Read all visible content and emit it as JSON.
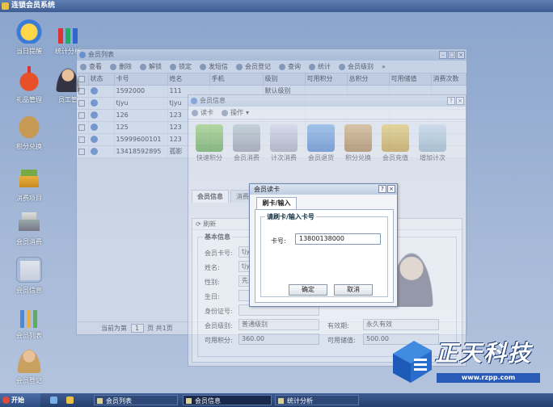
{
  "app": {
    "title": "连锁会员系统"
  },
  "desktop_icons": [
    {
      "label": "当日提醒",
      "icon": "smiley-clock-icon"
    },
    {
      "label": "统计分析",
      "icon": "bar-chart-icon"
    },
    {
      "label": "礼品管理",
      "icon": "gift-icon"
    },
    {
      "label": "员工管",
      "icon": "staff-icon"
    },
    {
      "label": "积分兑换",
      "icon": "money-bag-icon"
    },
    {
      "label": "消费项目",
      "icon": "basket-icon"
    },
    {
      "label": "会员消费",
      "icon": "cash-register-icon"
    },
    {
      "label": "会员信息",
      "icon": "member-card-icon"
    },
    {
      "label": "会员列表",
      "icon": "list-chart-icon"
    },
    {
      "label": "会员登记",
      "icon": "register-person-icon"
    }
  ],
  "member_list_window": {
    "title": "会员列表",
    "toolbar": [
      "查看",
      "删除",
      "解锁",
      "锁定",
      "发短信",
      "会员登记",
      "查询",
      "统计",
      "会员级别"
    ],
    "overflow": "»",
    "columns": [
      "状态",
      "卡号",
      "姓名",
      "手机",
      "级别",
      "可用积分",
      "总积分",
      "可用储值",
      "消费次数"
    ],
    "rows": [
      {
        "card": "1592000",
        "name": "111",
        "level": "默认级别"
      },
      {
        "card": "tjyu",
        "name": "tjyu"
      },
      {
        "card": "126",
        "name": "123"
      },
      {
        "card": "125",
        "name": "123"
      },
      {
        "card": "15999600101",
        "name": "123"
      },
      {
        "card": "13418592895",
        "name": "孤影"
      }
    ],
    "pager": {
      "prefix": "当前为第",
      "page": "1",
      "suffix": "页 共1页"
    }
  },
  "member_info_window": {
    "title": "会员信息",
    "toolbar": [
      "读卡",
      "操作"
    ],
    "actions": [
      "快速积分",
      "会员消费",
      "计次消费",
      "会员退货",
      "积分兑换",
      "会员充值",
      "增加计次"
    ],
    "tabs": [
      "会员信息",
      "消费"
    ],
    "refresh": "刷新",
    "section": "基本信息",
    "fields": {
      "card_label": "会员卡号:",
      "card_value": "tjyu",
      "name_label": "姓名:",
      "name_value": "tjyu",
      "gender_label": "性别:",
      "gender_value": "先生",
      "birthday_label": "生日:",
      "id_label": "身份证号:",
      "level_label": "会员级别:",
      "level_value": "普通级别",
      "valid_label": "有效期:",
      "valid_value": "永久有效",
      "points_label": "可用积分:",
      "points_value": "360.00",
      "balance_label": "可用储值:",
      "balance_value": "500.00"
    }
  },
  "read_card_dialog": {
    "title": "会员读卡",
    "tab": "刷卡/输入",
    "group_title": "请刷卡/输入卡号",
    "card_label": "卡号:",
    "card_value": "13800138000",
    "ok": "确定",
    "cancel": "取消"
  },
  "taskbar": {
    "start": "开始",
    "tasks": [
      "会员列表",
      "会员信息",
      "统计分析"
    ]
  },
  "logo": {
    "brand": "正天科技",
    "url": "www.rzpp.com"
  },
  "colors": {
    "desktop": "#a6b9d8",
    "titlebar": "#3e5d92",
    "accent": "#2a5bb6"
  }
}
